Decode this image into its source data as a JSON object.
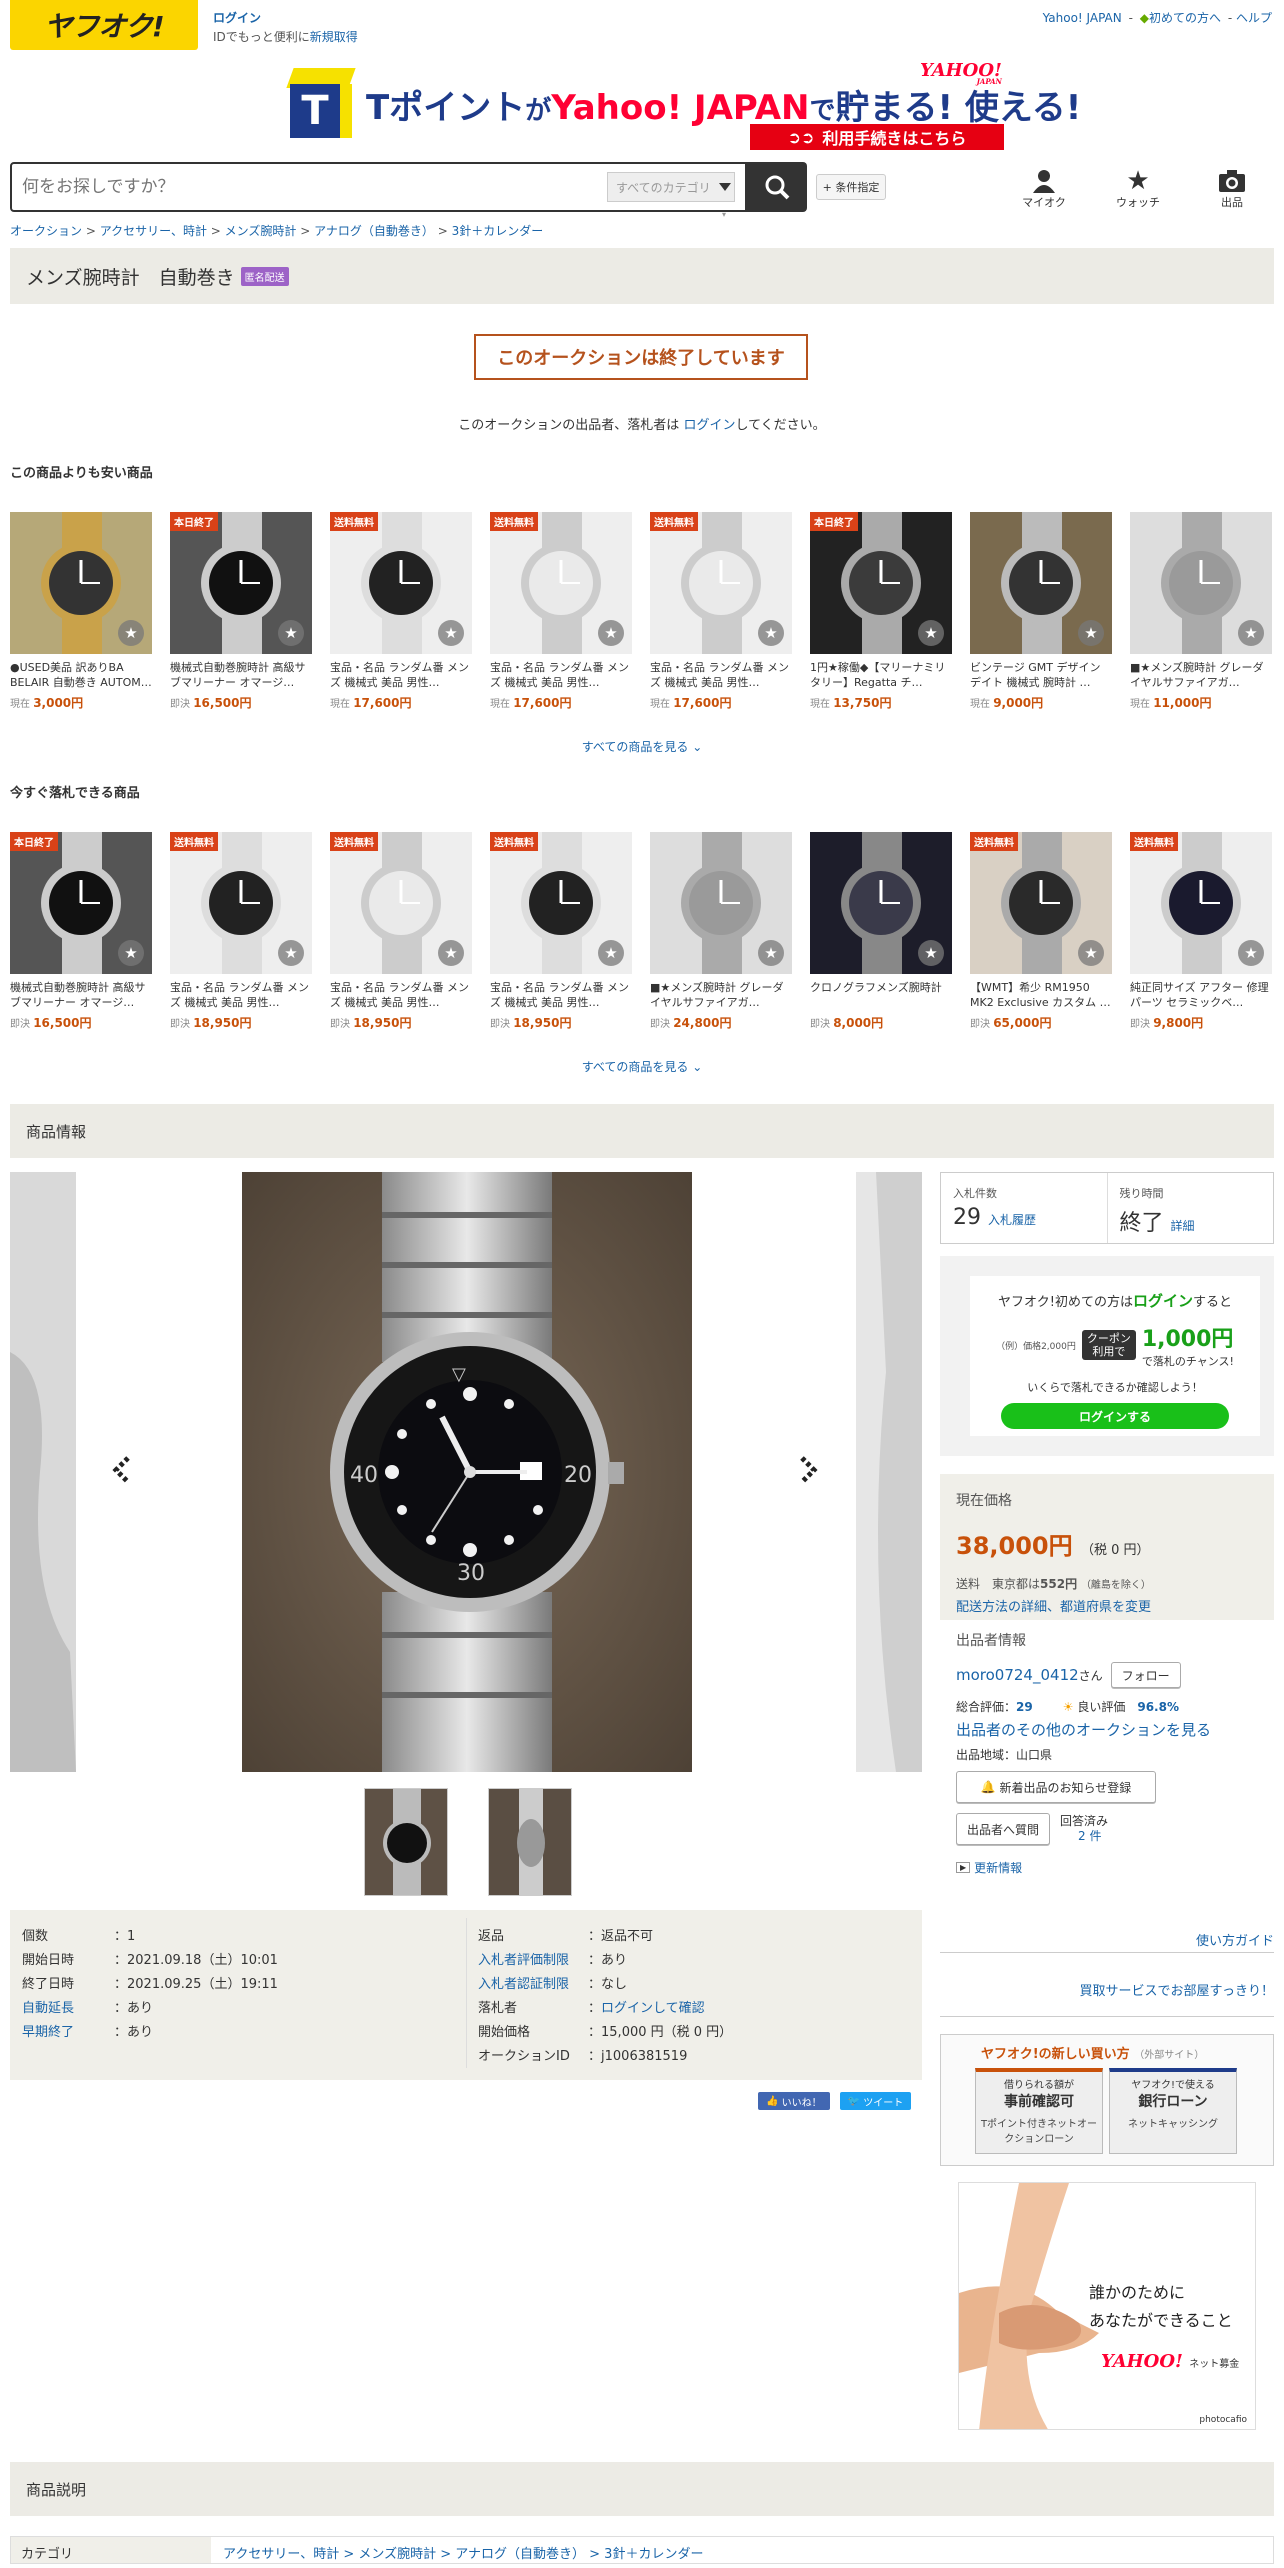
{
  "header": {
    "logo": "ヤフオク!",
    "login_link": "ログイン",
    "login_sub_prefix": "IDでもっと便利に",
    "register_link": "新規取得",
    "top_links": [
      "Yahoo! JAPAN",
      "-",
      "初めての方へ",
      "-",
      "ヘルプ"
    ]
  },
  "banner": {
    "t_letter": "T",
    "text_1": "Tポイント",
    "text_2": "が",
    "text_3": "Yahoo! JAPAN",
    "text_4": "で",
    "text_5": "貯まる! 使える!",
    "yahoo_logo": "YAHOO!",
    "yahoo_logo_sub": "JAPAN",
    "button": "利用手続きはこちら"
  },
  "search": {
    "placeholder": "何をお探しですか？",
    "category": "すべてのカテゴリ",
    "condition_button": "+ 条件指定"
  },
  "top_icons": {
    "myauc": "マイオク",
    "watch": "ウォッチ",
    "sell": "出品"
  },
  "breadcrumb": [
    "オークション",
    "アクセサリー、時計",
    "メンズ腕時計",
    "アナログ（自動巻き）",
    "3針＋カレンダー"
  ],
  "category_title": "メンズ腕時計　自動巻き",
  "category_badge": "匿名配送",
  "ended_notice": "このオークションは終了しています",
  "login_note_prefix": "このオークションの出品者、落札者は ",
  "login_note_link": "ログイン",
  "login_note_suffix": "してください。",
  "cheaper": {
    "title": "この商品よりも安い商品",
    "see_all": "すべての商品を見る",
    "items": [
      {
        "tag": "",
        "title": "●USED美品 訳ありBA BELAIR 自動巻き AUTOM…",
        "price_label": "現在",
        "price": "3,000円"
      },
      {
        "tag": "本日終了",
        "title": "機械式自動巻腕時計 高級サブマリーナー オマージ…",
        "price_label": "即決",
        "price": "16,500円"
      },
      {
        "tag": "送料無料",
        "title": "宝品・名品 ランダム番 メンズ 機械式 美品 男性…",
        "price_label": "現在",
        "price": "17,600円"
      },
      {
        "tag": "送料無料",
        "title": "宝品・名品 ランダム番 メンズ 機械式 美品 男性…",
        "price_label": "現在",
        "price": "17,600円"
      },
      {
        "tag": "送料無料",
        "title": "宝品・名品 ランダム番 メンズ 機械式 美品 男性…",
        "price_label": "現在",
        "price": "17,600円"
      },
      {
        "tag": "本日終了",
        "title": "1円★稼働◆【マリーナミリタリー】Regatta チ…",
        "price_label": "現在",
        "price": "13,750円"
      },
      {
        "tag": "",
        "title": "ビンテージ GMT デザイン デイト 機械式 腕時計 …",
        "price_label": "現在",
        "price": "9,000円"
      },
      {
        "tag": "",
        "title": "■★メンズ腕時計 グレーダイヤルサファイアガ…",
        "price_label": "現在",
        "price": "11,000円"
      }
    ]
  },
  "buynow": {
    "title": "今すぐ落札できる商品",
    "see_all": "すべての商品を見る",
    "items": [
      {
        "tag": "本日終了",
        "title": "機械式自動巻腕時計 高級サブマリーナー オマージ…",
        "price_label": "即決",
        "price": "16,500円"
      },
      {
        "tag": "送料無料",
        "title": "宝品・名品 ランダム番 メンズ 機械式 美品 男性…",
        "price_label": "即決",
        "price": "18,950円"
      },
      {
        "tag": "送料無料",
        "title": "宝品・名品 ランダム番 メンズ 機械式 美品 男性…",
        "price_label": "即決",
        "price": "18,950円"
      },
      {
        "tag": "送料無料",
        "title": "宝品・名品 ランダム番 メンズ 機械式 美品 男性…",
        "price_label": "即決",
        "price": "18,950円"
      },
      {
        "tag": "",
        "title": "■★メンズ腕時計 グレーダイヤルサファイアガ…",
        "price_label": "即決",
        "price": "24,800円"
      },
      {
        "tag": "",
        "title": "クロノグラフメンズ腕時計",
        "price_label": "即決",
        "price": "8,000円"
      },
      {
        "tag": "送料無料",
        "title": "【WMT】希少 RM1950 MK2 Exclusive カスタム …",
        "price_label": "即決",
        "price": "65,000円"
      },
      {
        "tag": "送料無料",
        "title": "純正同サイズ アフター 修理パーツ セラミックベ…",
        "price_label": "即決",
        "price": "9,800円"
      }
    ]
  },
  "item_info_title": "商品情報",
  "spec_left": [
    {
      "k": "個数",
      "v": "1",
      "k_link": false,
      "v_link": false
    },
    {
      "k": "開始日時",
      "v": "2021.09.18（土）10:01",
      "k_link": false,
      "v_link": false
    },
    {
      "k": "終了日時",
      "v": "2021.09.25（土）19:11",
      "k_link": false,
      "v_link": false
    },
    {
      "k": "自動延長",
      "v": "あり",
      "k_link": true,
      "v_link": false
    },
    {
      "k": "早期終了",
      "v": "あり",
      "k_link": true,
      "v_link": false
    }
  ],
  "spec_right": [
    {
      "k": "返品",
      "v": "返品不可",
      "k_link": false,
      "v_link": false
    },
    {
      "k": "入札者評価制限",
      "v": "あり",
      "k_link": true,
      "v_link": false
    },
    {
      "k": "入札者認証制限",
      "v": "なし",
      "k_link": true,
      "v_link": false
    },
    {
      "k": "落札者",
      "v": "ログインして確認",
      "k_link": false,
      "v_link": true
    },
    {
      "k": "開始価格",
      "v": "15,000 円（税 0 円）",
      "k_link": false,
      "v_link": false
    },
    {
      "k": "オークションID",
      "v": "j1006381519",
      "k_link": false,
      "v_link": false
    }
  ],
  "share": {
    "like": "いいね！",
    "tweet": "ツイート"
  },
  "bid": {
    "count_label": "入札件数",
    "count": "29",
    "history_link": "入札履歴",
    "time_label": "残り時間",
    "time": "終了",
    "detail_link": "詳細"
  },
  "promo": {
    "line1_prefix": "ヤフオク!初めての方は",
    "line1_link": "ログイン",
    "line1_suffix": "すると",
    "example": "（例）価格2,000円",
    "coupon": "クーポン 利用で",
    "amount": "1,000円",
    "amount_suffix": "で落札のチャンス!",
    "note": "いくらで落札できるか確認しよう！",
    "button": "ログインする"
  },
  "price": {
    "label": "現在価格",
    "value": "38,000円",
    "tax": "（税 0 円）",
    "ship_label": "送料",
    "ship_text": "東京都は",
    "ship_value": "552円",
    "ship_note": "（離島を除く）",
    "ship_link": "配送方法の詳細、都道府県を変更"
  },
  "seller": {
    "title": "出品者情報",
    "name": "moro0724_0412",
    "name_suffix": "さん",
    "follow": "フォロー",
    "rating_label": "総合評価：",
    "rating": "29",
    "good_label": "良い評価",
    "good_pct": "96.8%",
    "other_link": "出品者のその他のオークションを見る",
    "region": "出品地域：山口県",
    "notify_btn": "新着出品のお知らせ登録",
    "question_btn": "出品者へ質問",
    "answered": "回答済み",
    "answered_count": "2 件",
    "update_link": "更新情報"
  },
  "guide_link": "使い方ガイド",
  "service_link": "買取サービスでお部屋すっきり！",
  "newbuy": {
    "title": "ヤフオク!の新しい買い方",
    "sub": "（外部サイト）",
    "a_top": "借りられる額が",
    "a_main": "事前確認可",
    "a_bot": "Tポイント付きネットオークションローン",
    "b_top": "ヤフオク!で使える",
    "b_main": "銀行ローン",
    "b_bot": "ネットキャッシング"
  },
  "ad": {
    "line1": "誰かのために",
    "line2": "あなたができること",
    "brand": "YAHOO!",
    "brand_sub": "ネット募金",
    "credit": "photocafio"
  },
  "desc_title": "商品説明",
  "category_row": {
    "key": "カテゴリ",
    "value": "アクセサリー、時計 > メンズ腕時計 > アナログ（自動巻き） > 3針＋カレンダー"
  },
  "colors": {
    "accent": "#c8510a",
    "link": "#1a64a8",
    "yellow": "#fbd500",
    "tag_red": "#d94218",
    "green": "#19c019"
  }
}
